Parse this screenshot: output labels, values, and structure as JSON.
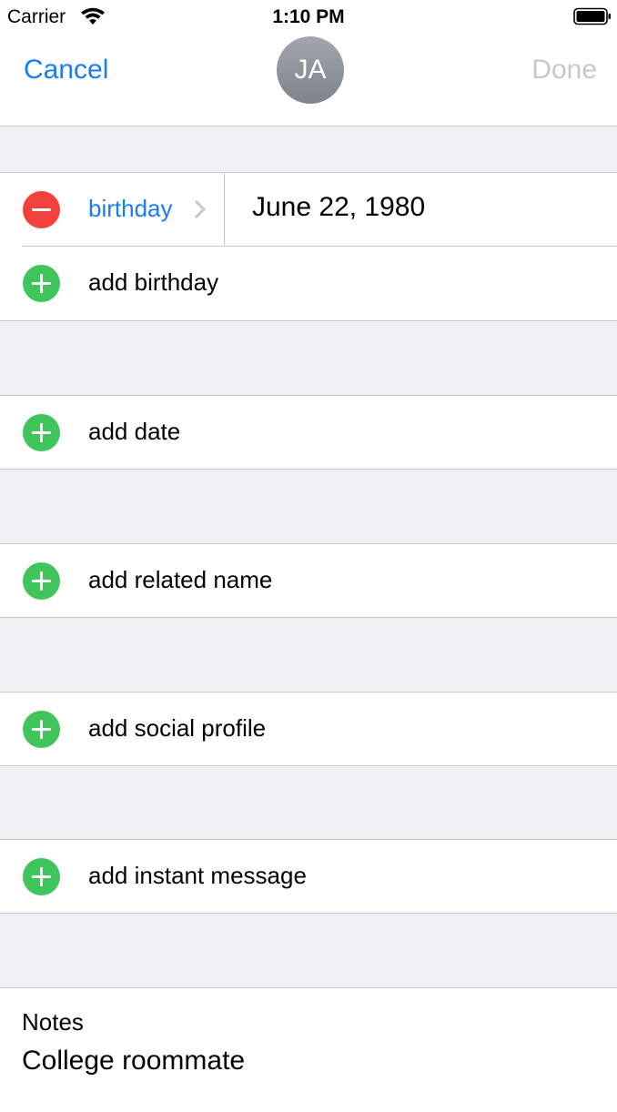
{
  "status_bar": {
    "carrier": "Carrier",
    "time": "1:10 PM"
  },
  "nav": {
    "cancel_label": "Cancel",
    "done_label": "Done",
    "avatar_initials": "JA"
  },
  "birthday_row": {
    "label": "birthday",
    "value": "June 22, 1980"
  },
  "rows": {
    "add_birthday": "add birthday",
    "add_date": "add date",
    "add_related_name": "add related name",
    "add_social_profile": "add social profile",
    "add_instant_message": "add instant message"
  },
  "notes": {
    "label": "Notes",
    "value": "College roommate"
  },
  "colors": {
    "accent": "#1a7cf5",
    "add": "#3fc55b",
    "remove": "#f4403b",
    "disabled": "#c7c7cc",
    "grouped_background": "#efeff4"
  }
}
